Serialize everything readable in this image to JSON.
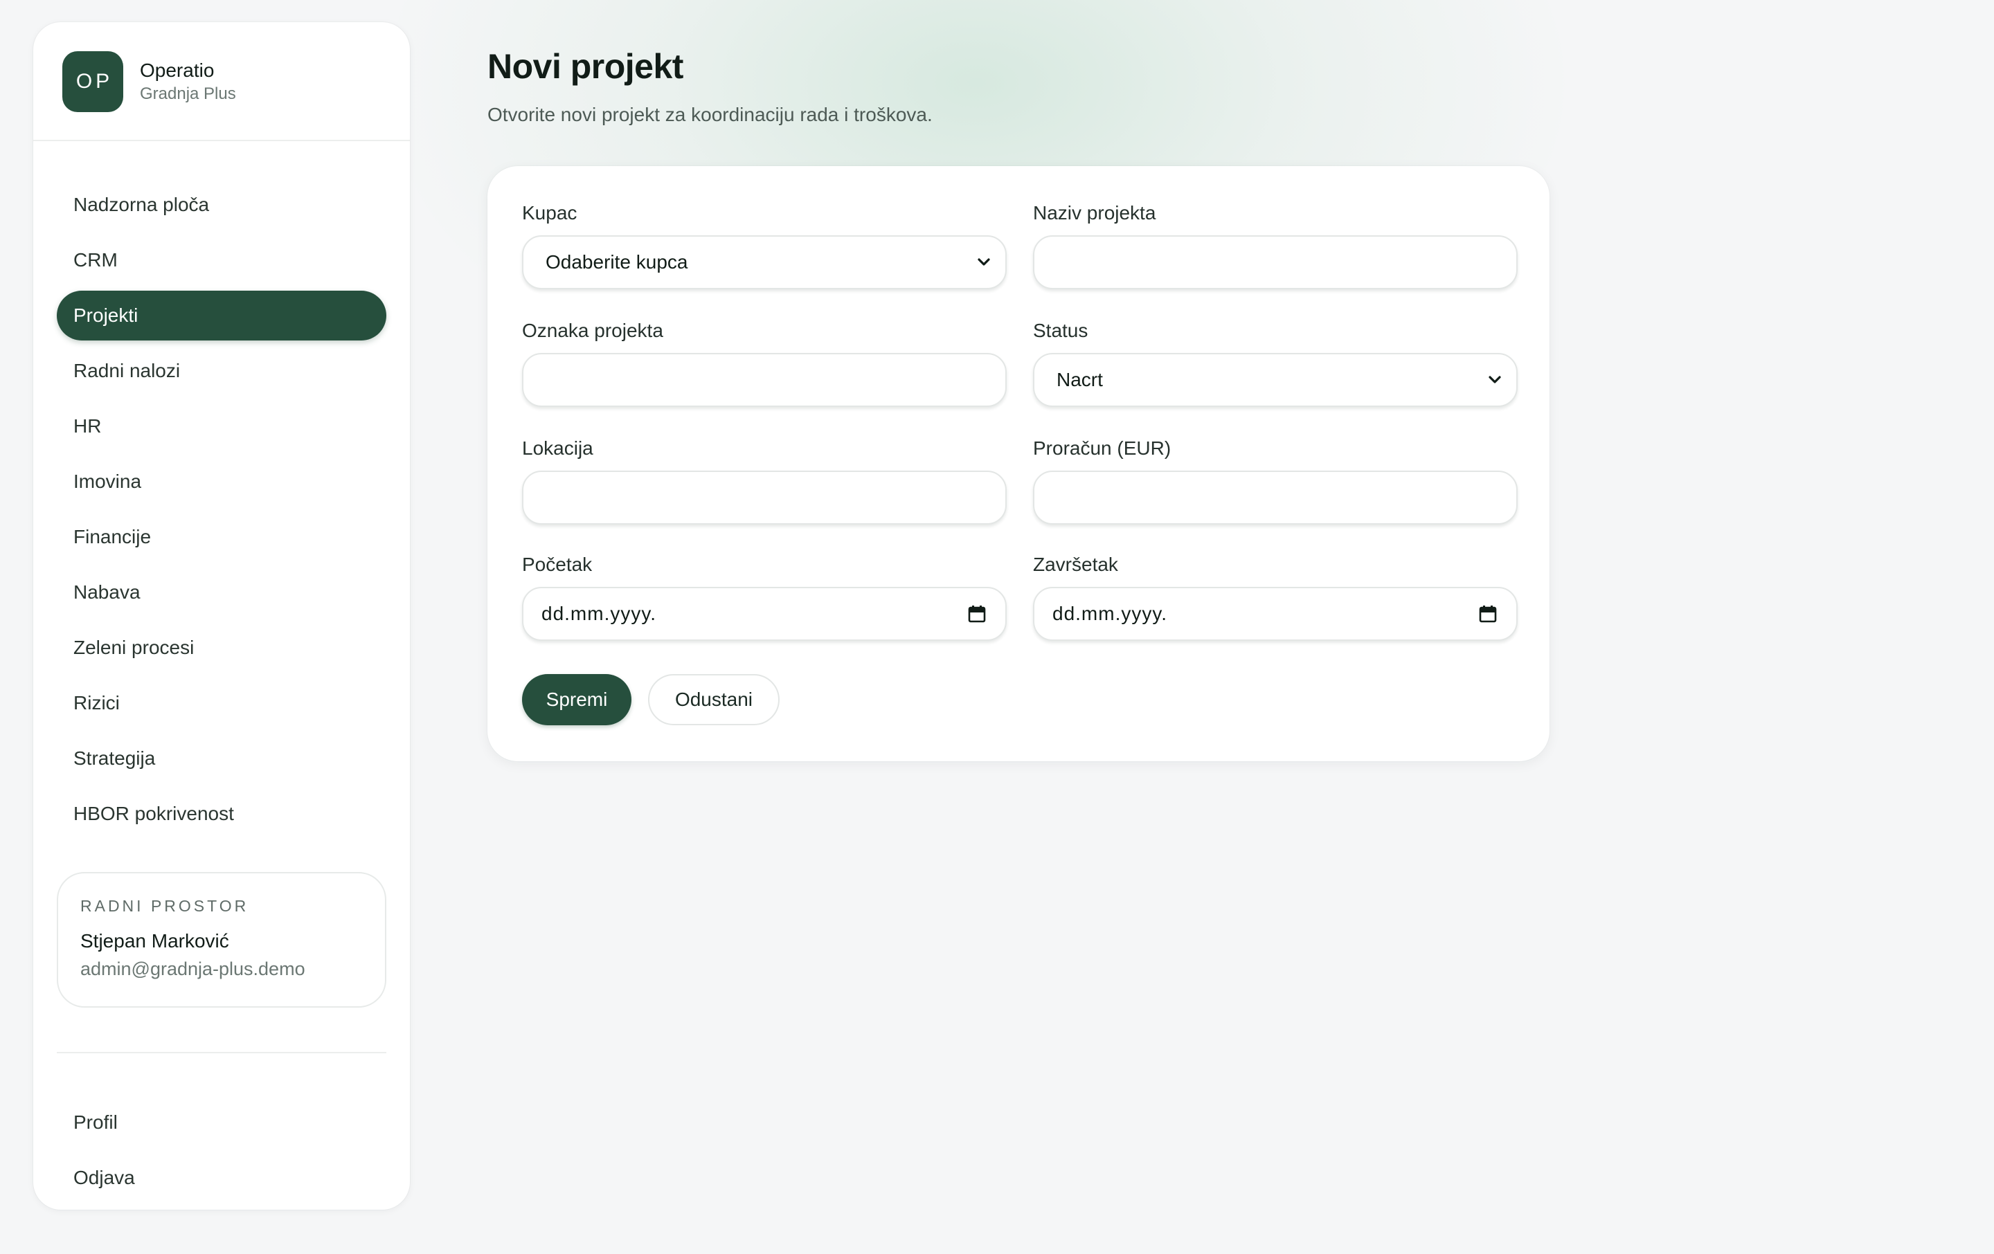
{
  "brand": {
    "logo_text": "OP",
    "name": "Operatio",
    "company": "Gradnja Plus"
  },
  "sidebar": {
    "items": [
      {
        "label": "Nadzorna ploča",
        "active": false
      },
      {
        "label": "CRM",
        "active": false
      },
      {
        "label": "Projekti",
        "active": true
      },
      {
        "label": "Radni nalozi",
        "active": false
      },
      {
        "label": "HR",
        "active": false
      },
      {
        "label": "Imovina",
        "active": false
      },
      {
        "label": "Financije",
        "active": false
      },
      {
        "label": "Nabava",
        "active": false
      },
      {
        "label": "Zeleni procesi",
        "active": false
      },
      {
        "label": "Rizici",
        "active": false
      },
      {
        "label": "Strategija",
        "active": false
      },
      {
        "label": "HBOR pokrivenost",
        "active": false
      }
    ],
    "workspace": {
      "label": "RADNI PROSTOR",
      "user_name": "Stjepan Marković",
      "user_email": "admin@gradnja-plus.demo"
    },
    "bottom_items": [
      {
        "label": "Profil"
      },
      {
        "label": "Odjava"
      }
    ]
  },
  "page": {
    "title": "Novi projekt",
    "subtitle": "Otvorite novi projekt za koordinaciju rada i troškova."
  },
  "form": {
    "customer": {
      "label": "Kupac",
      "value": "Odaberite kupca"
    },
    "project_name": {
      "label": "Naziv projekta",
      "value": ""
    },
    "project_code": {
      "label": "Oznaka projekta",
      "value": ""
    },
    "status": {
      "label": "Status",
      "value": "Nacrt"
    },
    "location": {
      "label": "Lokacija",
      "value": ""
    },
    "budget": {
      "label": "Proračun (EUR)",
      "value": ""
    },
    "start_date": {
      "label": "Početak",
      "value": "dd.mm.yyyy."
    },
    "end_date": {
      "label": "Završetak",
      "value": "dd.mm.yyyy."
    },
    "save_label": "Spremi",
    "cancel_label": "Odustani"
  },
  "icons": {
    "select_arrow": "chevron-down-icon",
    "date_picker": "calendar-icon"
  },
  "colors": {
    "accent": "#264f3d",
    "background": "#f5f6f7",
    "card": "#ffffff"
  }
}
